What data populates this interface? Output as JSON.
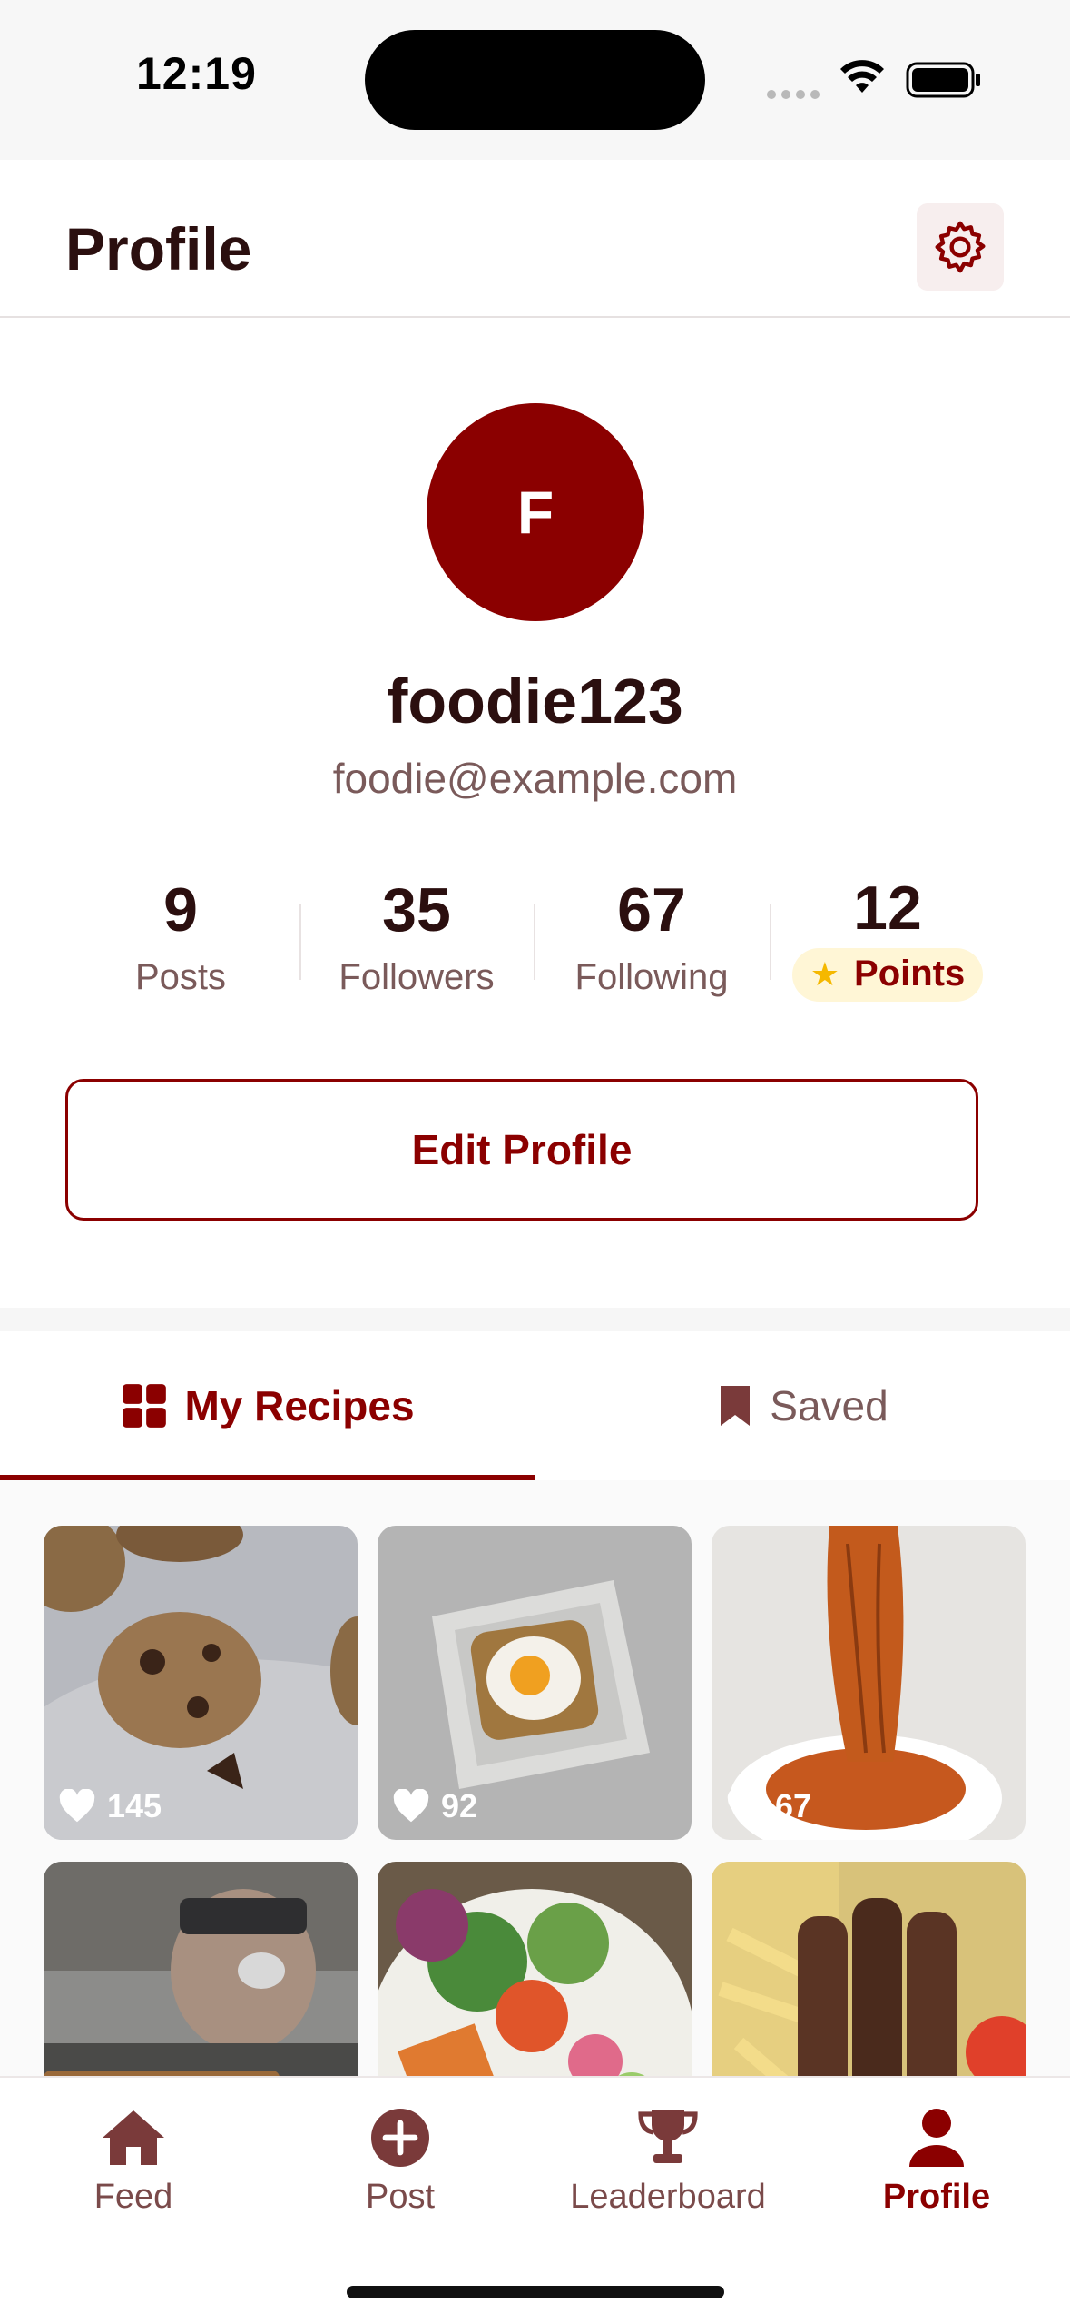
{
  "status_bar": {
    "time": "12:19"
  },
  "header": {
    "title": "Profile",
    "settings_icon": "gear-icon"
  },
  "profile": {
    "avatar_initial": "F",
    "avatar_color": "#8b0000",
    "username": "foodie123",
    "email": "foodie@example.com",
    "stats": [
      {
        "value": "9",
        "label": "Posts"
      },
      {
        "value": "35",
        "label": "Followers"
      },
      {
        "value": "67",
        "label": "Following"
      },
      {
        "value": "12",
        "label": "Points"
      }
    ],
    "edit_label": "Edit Profile"
  },
  "tabs": [
    {
      "label": "My Recipes",
      "icon": "grid-icon",
      "active": true
    },
    {
      "label": "Saved",
      "icon": "bookmark-icon",
      "active": false
    }
  ],
  "recipes": [
    {
      "likes": "145",
      "subject": "cookies"
    },
    {
      "likes": "92",
      "subject": "egg-toast"
    },
    {
      "likes": "67",
      "subject": "spaghetti"
    },
    {
      "likes": "",
      "subject": "coffee-machine"
    },
    {
      "likes": "",
      "subject": "salad"
    },
    {
      "likes": "",
      "subject": "kebab-fries"
    }
  ],
  "nav": [
    {
      "label": "Feed",
      "icon": "home-icon",
      "active": false
    },
    {
      "label": "Post",
      "icon": "plus-circle-icon",
      "active": false
    },
    {
      "label": "Leaderboard",
      "icon": "trophy-icon",
      "active": false
    },
    {
      "label": "Profile",
      "icon": "person-icon",
      "active": true
    }
  ],
  "colors": {
    "accent": "#8b0000",
    "text": "#2b0f0f",
    "muted": "#7a5a5a",
    "points_bg": "#fff6d6",
    "star": "#f5b800"
  }
}
